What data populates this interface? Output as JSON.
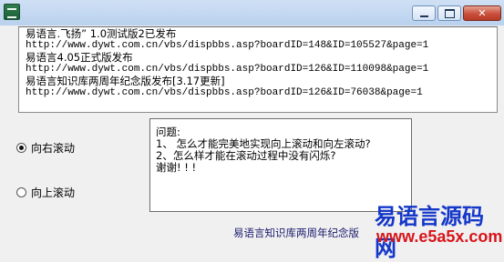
{
  "window": {
    "title": "",
    "controls": {
      "minimize_icon": "minimize-icon",
      "maximize_icon": "maximize-icon",
      "close_glyph": "✕"
    }
  },
  "text_panel": {
    "lines": [
      "易语言.飞扬” 1.0测试版2已发布",
      "http://www.dywt.com.cn/vbs/dispbbs.asp?boardID=148&ID=105527&page=1",
      "易语言4.05正式版发布",
      "http://www.dywt.com.cn/vbs/dispbbs.asp?boardID=126&ID=110098&page=1",
      "易语言知识库两周年纪念版发布[3.17更新]",
      "http://www.dywt.com.cn/vbs/dispbbs.asp?boardID=126&ID=76038&page=1"
    ]
  },
  "scroll_options": {
    "horizontal_label": "向右滚动",
    "vertical_label": "向上滚动",
    "selected": "horizontal"
  },
  "note_box": {
    "lines": [
      "问题:",
      "1、 怎么才能完美地实现向上滚动和向左滚动?",
      "2、怎么样才能在滚动过程中没有闪烁?",
      "谢谢! ! !"
    ]
  },
  "scrolling_banner": {
    "text": "易语言知识库两周年纪念版"
  },
  "watermark": {
    "name": "易语言源码网",
    "url": "www.e5a5x.com"
  },
  "colors": {
    "watermark_name": "#1437c9",
    "watermark_url": "#d7141a",
    "banner_text": "#1a1a6e"
  }
}
